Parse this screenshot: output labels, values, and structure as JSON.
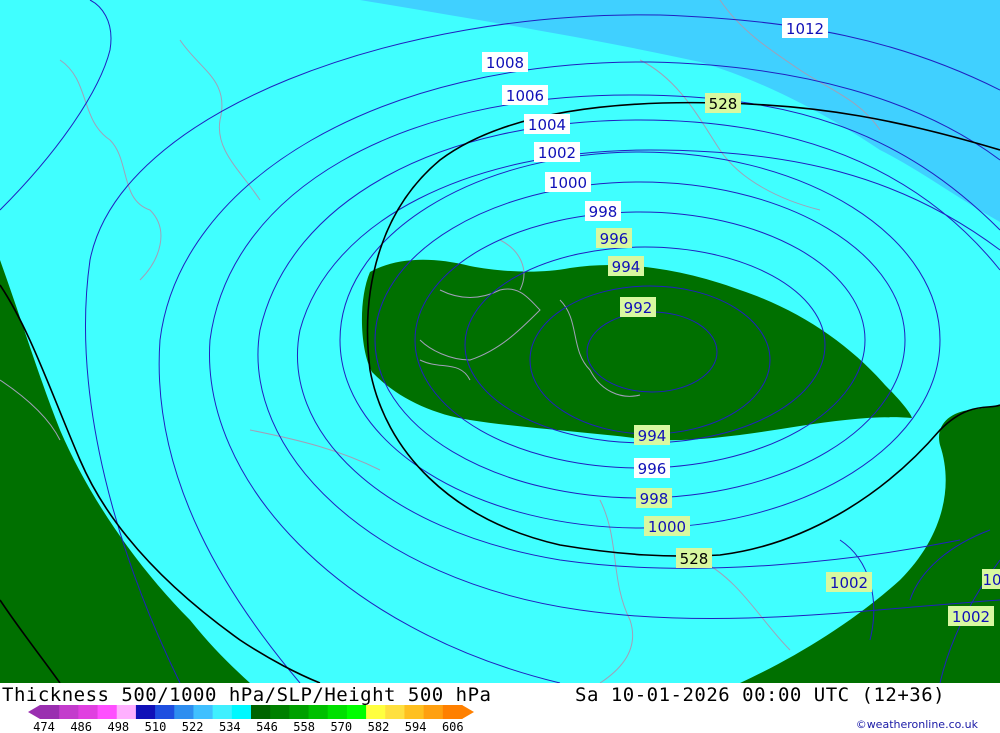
{
  "footer": {
    "title": "Thickness 500/1000 hPa/SLP/Height 500 hPa",
    "datetime": "Sa 10-01-2026 00:00 UTC (12+36)",
    "credit": "©weatheronline.co.uk"
  },
  "scale": {
    "ticks": [
      "474",
      "486",
      "498",
      "510",
      "522",
      "534",
      "546",
      "558",
      "570",
      "582",
      "594",
      "606"
    ],
    "colors": [
      "#9a2fb0",
      "#c33ccc",
      "#e040e0",
      "#ff4fff",
      "#ffb0ff",
      "#1010b8",
      "#1e4ee0",
      "#2e8ef0",
      "#40c0ff",
      "#40f0ff",
      "#00f8ff",
      "#006400",
      "#008000",
      "#00a000",
      "#00c000",
      "#00e000",
      "#00ff00",
      "#ffff40",
      "#ffe040",
      "#ffc020",
      "#ffa010",
      "#ff8000"
    ]
  },
  "isobar_labels": [
    {
      "text": "1012",
      "bg": "#ffffff",
      "fg": "#1010b8"
    },
    {
      "text": "1008",
      "bg": "#ffffff",
      "fg": "#1010b8"
    },
    {
      "text": "1006",
      "bg": "#ffffff",
      "fg": "#1010b8"
    },
    {
      "text": "1004",
      "bg": "#ffffff",
      "fg": "#1010b8"
    },
    {
      "text": "1002",
      "bg": "#ffffff",
      "fg": "#1010b8"
    },
    {
      "text": "1000",
      "bg": "#ffffff",
      "fg": "#1010b8"
    },
    {
      "text": "998",
      "bg": "#ffffff",
      "fg": "#1010b8"
    },
    {
      "text": "996",
      "bg": "#d8f8a0",
      "fg": "#1010b8"
    },
    {
      "text": "994",
      "bg": "#d8f8a0",
      "fg": "#1010b8"
    },
    {
      "text": "992",
      "bg": "#d8f8a0",
      "fg": "#1010b8"
    },
    {
      "text": "994",
      "bg": "#d8f8a0",
      "fg": "#1010b8"
    },
    {
      "text": "996",
      "bg": "#ffffff",
      "fg": "#1010b8"
    },
    {
      "text": "998",
      "bg": "#d8f8a0",
      "fg": "#1010b8"
    },
    {
      "text": "1000",
      "bg": "#d8f8a0",
      "fg": "#1010b8"
    },
    {
      "text": "1002",
      "bg": "#d8f8a0",
      "fg": "#1010b8"
    },
    {
      "text": "1002",
      "bg": "#d8f8a0",
      "fg": "#1010b8"
    },
    {
      "text": "10",
      "bg": "#d8f8a0",
      "fg": "#1010b8"
    }
  ],
  "height_labels": [
    {
      "text": "528",
      "bg": "#d8f8a0",
      "fg": "#000000"
    },
    {
      "text": "528",
      "bg": "#d8f8a0",
      "fg": "#000000"
    }
  ],
  "colors": {
    "cyan": "#40ffff",
    "sky": "#40d0ff",
    "green": "#007000",
    "isobar": "#2020c0",
    "height": "#000000",
    "coast": "#a0a0b8"
  }
}
